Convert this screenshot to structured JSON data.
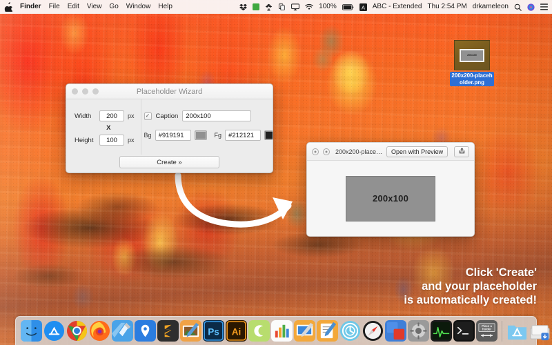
{
  "menubar": {
    "apple_icon": "apple-logo-icon",
    "items": [
      {
        "label": "Finder",
        "bold": true
      },
      {
        "label": "File",
        "bold": false
      },
      {
        "label": "Edit",
        "bold": false
      },
      {
        "label": "View",
        "bold": false
      },
      {
        "label": "Go",
        "bold": false
      },
      {
        "label": "Window",
        "bold": false
      },
      {
        "label": "Help",
        "bold": false
      }
    ],
    "status": {
      "battery_percent": "100%",
      "input_source": "ABC - Extended",
      "clock": "Thu 2:54 PM",
      "user": "drkameleon",
      "icons": [
        "dropbox-icon",
        "green-square-icon",
        "dropbox-sync-icon",
        "copy-icon",
        "airplay-icon",
        "wifi-icon",
        "battery-icon",
        "keyboard-input-icon",
        "spotlight-search-icon",
        "siri-icon",
        "notification-center-icon"
      ]
    }
  },
  "desktop_icon": {
    "name": "200x200-placeholder.png",
    "thumb_caption": "200x100",
    "selected": true
  },
  "wizard": {
    "title": "Placeholder Wizard",
    "traffic_lights": [
      "close-button",
      "minimize-button",
      "zoom-button"
    ],
    "width_label": "Width",
    "width_value": "200",
    "width_unit": "px",
    "multiply_symbol": "X",
    "height_label": "Height",
    "height_value": "100",
    "height_unit": "px",
    "caption_checkbox_label": "Caption",
    "caption_checked": true,
    "caption_check_glyph": "✓",
    "caption_value": "200x100",
    "bg_label": "Bg",
    "bg_value": "#919191",
    "bg_color": "#919191",
    "fg_label": "Fg",
    "fg_value": "#212121",
    "fg_color": "#212121",
    "create_button": "Create »"
  },
  "preview": {
    "filename": "200x200-place…",
    "open_button": "Open with Preview",
    "share_icon": "share-icon",
    "image_caption": "200x100",
    "image_bg": "#919191",
    "image_fg": "#212121"
  },
  "promo": {
    "line1": "Click 'Create'",
    "line2": "and your placeholder",
    "line3": "is automatically created!",
    "color": "#ffffff"
  },
  "dock": {
    "items": [
      {
        "name": "finder",
        "label": "",
        "kind": "finder",
        "running": true
      },
      {
        "name": "app-store",
        "label": "",
        "kind": "appstore",
        "running": false
      },
      {
        "name": "google-chrome",
        "label": "",
        "kind": "chrome",
        "running": true
      },
      {
        "name": "firefox",
        "label": "",
        "kind": "firefox",
        "running": false
      },
      {
        "name": "xcode",
        "label": "",
        "kind": "xcode",
        "running": true
      },
      {
        "name": "maps",
        "label": "",
        "kind": "maps",
        "running": false
      },
      {
        "name": "sublime-text",
        "label": "",
        "kind": "sublime",
        "running": false
      },
      {
        "name": "pixelmator",
        "label": "",
        "kind": "pixelmator",
        "running": false
      },
      {
        "name": "photoshop",
        "label": "Ps",
        "kind": "ps",
        "running": false
      },
      {
        "name": "illustrator",
        "label": "Ai",
        "kind": "ai",
        "running": false
      },
      {
        "name": "cleanmymac",
        "label": "C",
        "kind": "cmm",
        "running": false
      },
      {
        "name": "numbers",
        "label": "",
        "kind": "numbers",
        "running": false
      },
      {
        "name": "keynote",
        "label": "",
        "kind": "keynote",
        "running": false
      },
      {
        "name": "pages",
        "label": "",
        "kind": "pages",
        "running": false
      },
      {
        "name": "time-machine",
        "label": "",
        "kind": "timemachine",
        "running": false
      },
      {
        "name": "safari",
        "label": "",
        "kind": "safari",
        "running": false
      },
      {
        "name": "screen-sharing",
        "label": "",
        "kind": "sharing",
        "running": false
      },
      {
        "name": "system-preferences",
        "label": "",
        "kind": "syspref",
        "running": false
      },
      {
        "name": "activity-monitor",
        "label": "",
        "kind": "activity",
        "running": false
      },
      {
        "name": "terminal",
        "label": "",
        "kind": "terminal",
        "running": false
      },
      {
        "name": "place-a-holder",
        "label": "Place a holder",
        "kind": "placeholder",
        "running": true
      }
    ],
    "stacks": [
      {
        "name": "applications-folder",
        "kind": "appsfolder"
      },
      {
        "name": "downloads-stack",
        "kind": "downloads"
      },
      {
        "name": "documents-stack",
        "kind": "documents"
      },
      {
        "name": "recent-stack",
        "kind": "recent"
      },
      {
        "name": "trash",
        "kind": "trash"
      }
    ],
    "separator": "dock-separator"
  }
}
